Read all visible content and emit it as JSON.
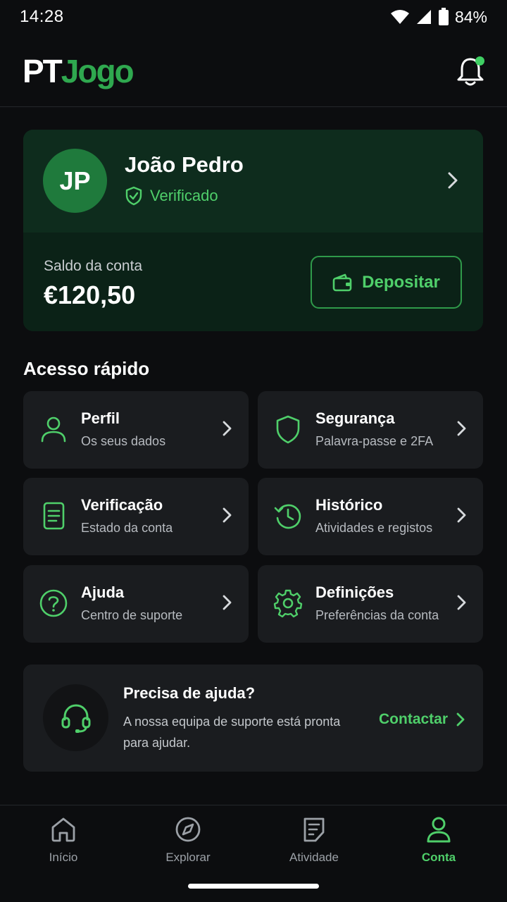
{
  "status_bar": {
    "time": "14:28",
    "battery": "84%"
  },
  "header": {
    "logo_pt": "PT",
    "logo_jogo": "Jogo",
    "accent": "#2fa84f"
  },
  "profile": {
    "initials": "JP",
    "name": "João Pedro",
    "status": "Verificado",
    "balance_label": "Saldo da conta",
    "balance_value": "€120,50",
    "deposit_label": "Depositar"
  },
  "quick_access": {
    "title": "Acesso rápido",
    "items": [
      {
        "title": "Perfil",
        "subtitle": "Os seus dados",
        "icon": "user-icon"
      },
      {
        "title": "Segurança",
        "subtitle": "Palavra-passe e 2FA",
        "icon": "shield-icon"
      },
      {
        "title": "Verificação",
        "subtitle": "Estado da conta",
        "icon": "document-icon"
      },
      {
        "title": "Histórico",
        "subtitle": "Atividades e registos",
        "icon": "history-icon"
      },
      {
        "title": "Ajuda",
        "subtitle": "Centro de suporte",
        "icon": "help-icon"
      },
      {
        "title": "Definições",
        "subtitle": "Preferências da conta",
        "icon": "gear-icon"
      }
    ]
  },
  "help_card": {
    "title": "Precisa de ajuda?",
    "text": "A nossa equipa de suporte está pronta para ajudar.",
    "link": "Contactar"
  },
  "bottom_nav": {
    "items": [
      {
        "label": "Início",
        "icon": "home-icon"
      },
      {
        "label": "Explorar",
        "icon": "compass-icon"
      },
      {
        "label": "Atividade",
        "icon": "activity-icon"
      },
      {
        "label": "Conta",
        "icon": "account-icon",
        "active": true
      }
    ]
  }
}
